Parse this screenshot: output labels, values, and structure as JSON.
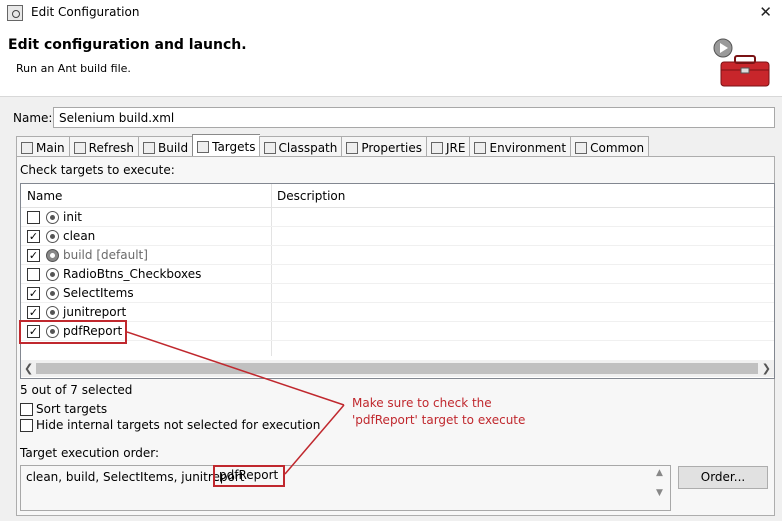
{
  "window": {
    "title": "Edit Configuration",
    "close": "✕"
  },
  "header": {
    "title": "Edit configuration and launch.",
    "message": "Run an Ant build file."
  },
  "name_label": "Name:",
  "name_value": "Selenium build.xml",
  "tabs": [
    {
      "label": "Main",
      "icon": "main-icon"
    },
    {
      "label": "Refresh",
      "icon": "refresh-icon"
    },
    {
      "label": "Build",
      "icon": "build-icon"
    },
    {
      "label": "Targets",
      "icon": "targets-icon",
      "active": true
    },
    {
      "label": "Classpath",
      "icon": "classpath-icon"
    },
    {
      "label": "Properties",
      "icon": "properties-icon"
    },
    {
      "label": "JRE",
      "icon": "jre-icon"
    },
    {
      "label": "Environment",
      "icon": "environment-icon"
    },
    {
      "label": "Common",
      "icon": "common-icon"
    }
  ],
  "targets": {
    "section_label": "Check targets to execute:",
    "columns": [
      "Name",
      "Description"
    ],
    "rows": [
      {
        "name": "init",
        "checked": false
      },
      {
        "name": "clean",
        "checked": true
      },
      {
        "name": "build [default]",
        "checked": true,
        "default": true
      },
      {
        "name": "RadioBtns_Checkboxes",
        "checked": false
      },
      {
        "name": "SelectItems",
        "checked": true
      },
      {
        "name": "junitreport",
        "checked": true
      },
      {
        "name": "pdfReport",
        "checked": true
      }
    ],
    "count_text": "5 out of 7 selected"
  },
  "options": {
    "sort": "Sort targets",
    "hide": "Hide internal targets not selected for execution"
  },
  "order": {
    "label": "Target execution order:",
    "text_before": "clean, build, SelectItems, junitreport",
    "text_highlight": "pdfReport",
    "button": "Order..."
  },
  "annotation": {
    "line1": "Make sure to check the",
    "line2": "'pdfReport' target to execute"
  },
  "colors": {
    "annotation": "#c0282e",
    "selected_tab": "#ffffff",
    "panel": "#f7f7f7"
  }
}
